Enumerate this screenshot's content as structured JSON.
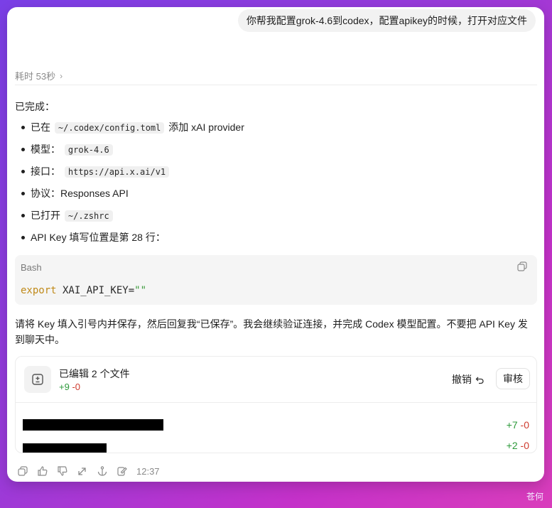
{
  "conversation": {
    "user_message": "你帮我配置grok-4.6到codex，配置apikey的时候，打开对应文件",
    "elapsed": "耗时 53秒",
    "intro": "已完成：",
    "bullets": [
      {
        "prefix": "已在",
        "code": "~/.codex/config.toml",
        "suffix": "添加 xAI provider"
      },
      {
        "prefix": "模型：",
        "code": "grok-4.6",
        "suffix": ""
      },
      {
        "prefix": "接口：",
        "code": "https://api.x.ai/v1",
        "suffix": ""
      },
      {
        "prefix": "协议：Responses API",
        "code": "",
        "suffix": ""
      },
      {
        "prefix": "已打开",
        "code": "~/.zshrc",
        "suffix": ""
      },
      {
        "prefix": "API Key 填写位置是第 28 行：",
        "code": "",
        "suffix": ""
      }
    ],
    "code_block": {
      "language": "Bash",
      "keyword": "export",
      "assignment": " XAI_API_KEY=",
      "value": "\"\""
    },
    "note": "请将 Key 填入引号内并保存，然后回复我“已保存”。我会继续验证连接，并完成 Codex 模型配置。不要把 API Key 发到聊天中。",
    "edit_card": {
      "title": "已编辑 2 个文件",
      "added": "+9",
      "removed": "-0",
      "undo_label": "撤销",
      "review_label": "审核",
      "files": [
        {
          "added": "+7",
          "removed": "-0"
        },
        {
          "added": "+2",
          "removed": "-0"
        }
      ]
    },
    "timestamp": "12:37"
  },
  "watermark": "苍何",
  "colors": {
    "added": "#2d9a3b",
    "removed": "#cf3b2e",
    "keyword": "#c08a1a",
    "string": "#3a9a3a"
  }
}
